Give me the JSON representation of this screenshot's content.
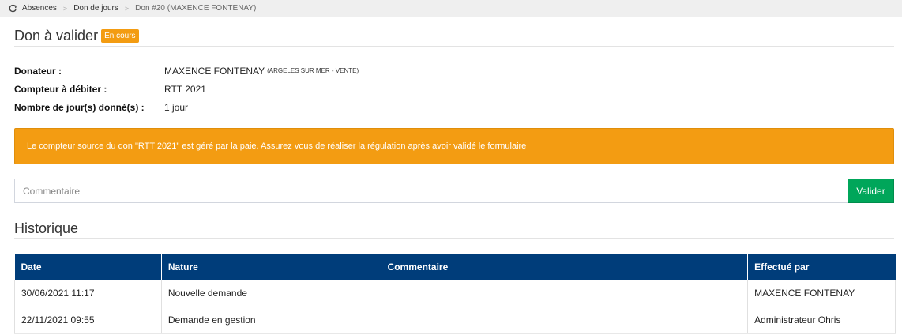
{
  "breadcrumb": {
    "icon": "refresh-icon",
    "items": [
      "Absences",
      "Don de jours"
    ],
    "current": "Don #20 (MAXENCE FONTENAY)"
  },
  "header": {
    "title": "Don à valider",
    "status": "En cours",
    "status_color": "#f39c12"
  },
  "info": {
    "donor_label": "Donateur :",
    "donor_name": "MAXENCE FONTENAY",
    "donor_location": "(ARGELES SUR MER - VENTE)",
    "counter_label": "Compteur à débiter :",
    "counter_value": "RTT 2021",
    "days_label": "Nombre de jour(s) donné(s) :",
    "days_value": "1 jour"
  },
  "alert": {
    "message": "Le compteur source du don \"RTT 2021\" est géré par la paie. Assurez vous de réaliser la régulation après avoir validé le formulaire",
    "color": "#f39c12"
  },
  "comment": {
    "placeholder": "Commentaire",
    "value": "",
    "submit_label": "Valider",
    "submit_color": "#00a65a"
  },
  "history": {
    "title": "Historique",
    "header_color": "#003d7a",
    "columns": [
      "Date",
      "Nature",
      "Commentaire",
      "Effectué par"
    ],
    "rows": [
      [
        "30/06/2021 11:17",
        "Nouvelle demande",
        "",
        "MAXENCE FONTENAY"
      ],
      [
        "22/11/2021 09:55",
        "Demande en gestion",
        "",
        "Administrateur Ohris"
      ]
    ]
  }
}
